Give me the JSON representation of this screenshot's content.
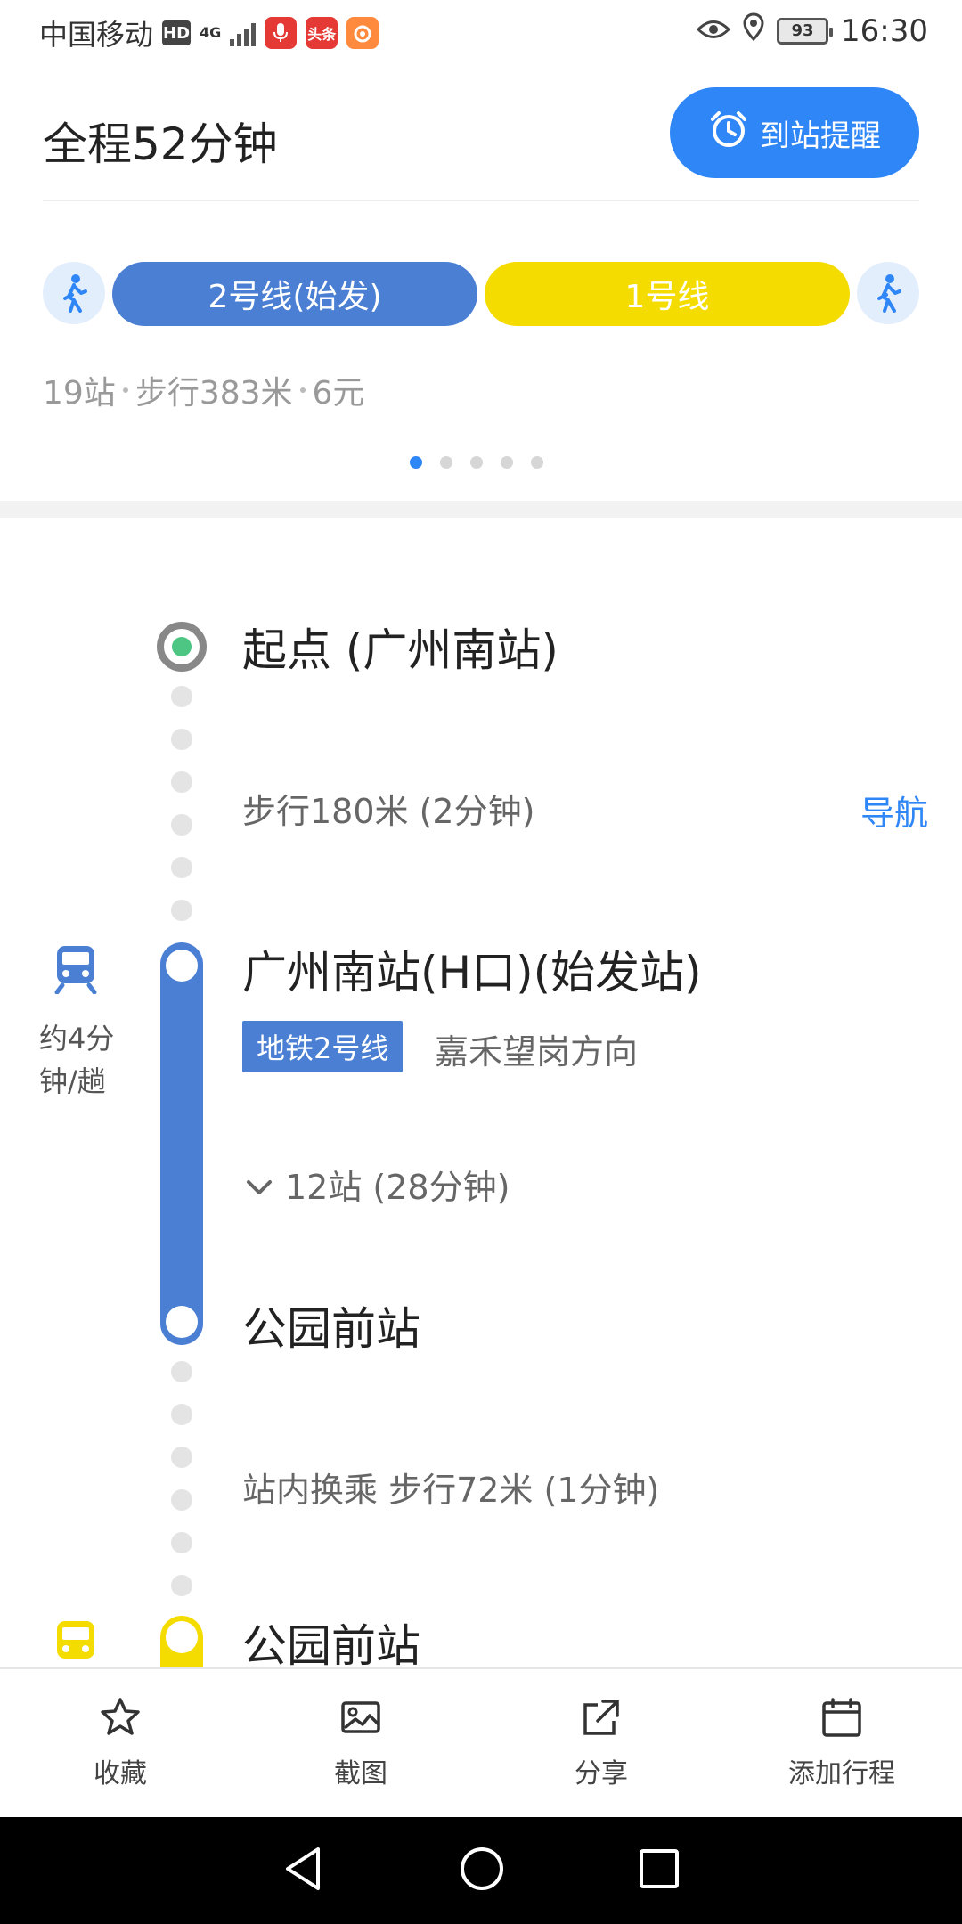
{
  "status_bar": {
    "carrier": "中国移动",
    "hd": "HD",
    "network": "4G",
    "app_toutiao": "头条",
    "battery": "93",
    "time": "16:30"
  },
  "summary": {
    "total_time": "全程52分钟",
    "alarm_button": "到站提醒",
    "lines": [
      {
        "label": "2号线(始发)",
        "color": "#4a7fd4"
      },
      {
        "label": "1号线",
        "color": "#f5dc00"
      }
    ],
    "stops": "19站",
    "walk": "步行383米",
    "fare": "6元",
    "pager": {
      "count": 5,
      "active": 0
    }
  },
  "timeline": {
    "start_label": "起点 (广州南站)",
    "walk1": "步行180米 (2分钟)",
    "nav_link": "导航",
    "board_station": "广州南站(H口)(始发站)",
    "frequency": "约4分钟/趟",
    "line_tag": "地铁2号线",
    "direction": "嘉禾望岗方向",
    "ride_summary": "12站 (28分钟)",
    "alight_station": "公园前站",
    "transfer": "站内换乘 步行72米 (1分钟)",
    "next_station": "公园前站"
  },
  "toolbar": {
    "favorite": "收藏",
    "screenshot": "截图",
    "share": "分享",
    "add_trip": "添加行程"
  },
  "colors": {
    "accent": "#2f86f6",
    "line2": "#4a7fd4",
    "line1": "#f5dc00",
    "start": "#4cc682"
  }
}
